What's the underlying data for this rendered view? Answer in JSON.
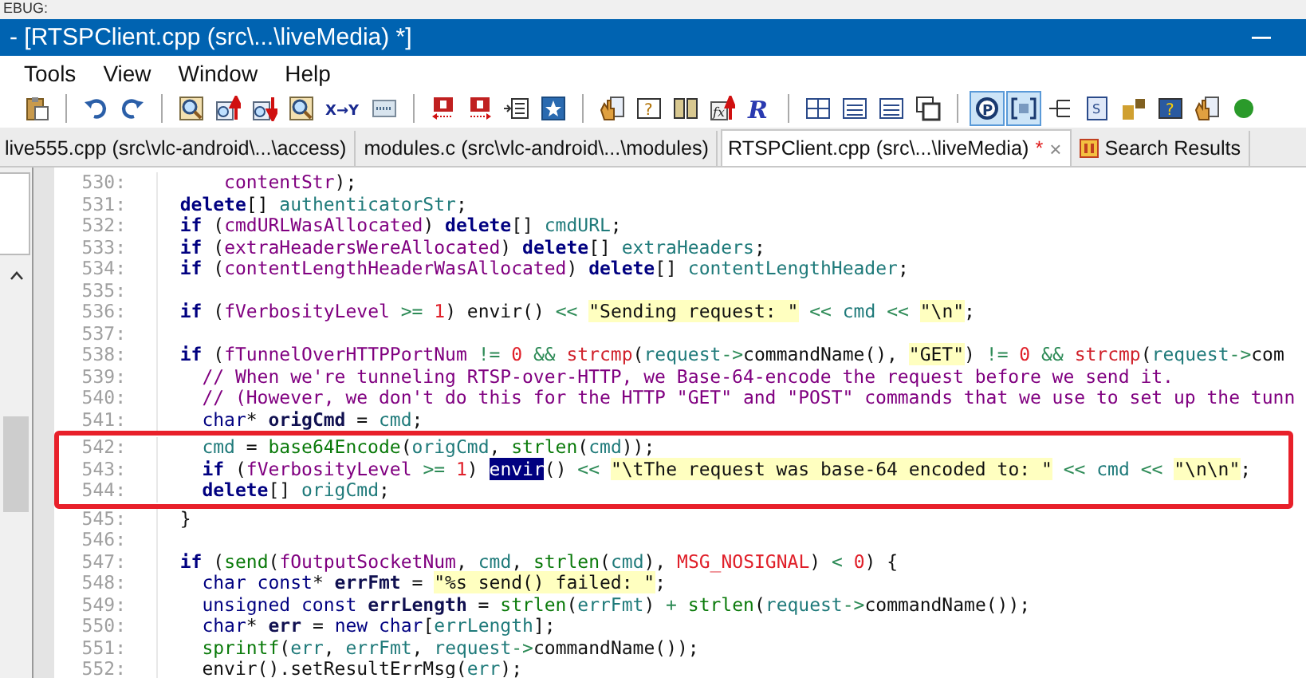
{
  "debug_strip": {
    "text": "EBUG:"
  },
  "window": {
    "title": "- [RTSPClient.cpp (src\\...\\liveMedia) *]"
  },
  "menu": [
    "Tools",
    "View",
    "Window",
    "Help"
  ],
  "toolbar": [
    {
      "kind": "paste",
      "pressed": false
    },
    {
      "kind": "separator"
    },
    {
      "kind": "undo",
      "pressed": false
    },
    {
      "kind": "redo",
      "pressed": false
    },
    {
      "kind": "separator"
    },
    {
      "kind": "find-page",
      "pressed": false
    },
    {
      "kind": "find-prev",
      "pressed": false
    },
    {
      "kind": "find-next",
      "pressed": false
    },
    {
      "kind": "find-page",
      "pressed": false
    },
    {
      "kind": "replace",
      "label": "X→Y",
      "pressed": false
    },
    {
      "kind": "web",
      "pressed": false
    },
    {
      "kind": "separator"
    },
    {
      "kind": "mark-prev",
      "pressed": false
    },
    {
      "kind": "mark-next",
      "pressed": false
    },
    {
      "kind": "indent",
      "pressed": false
    },
    {
      "kind": "star",
      "pressed": false
    },
    {
      "kind": "separator"
    },
    {
      "kind": "hand",
      "pressed": false
    },
    {
      "kind": "help-list",
      "label": "?",
      "pressed": false
    },
    {
      "kind": "book",
      "pressed": false
    },
    {
      "kind": "function",
      "label": "fx",
      "pressed": false
    },
    {
      "kind": "logo",
      "label": "R",
      "pressed": false
    },
    {
      "kind": "separator"
    },
    {
      "kind": "grid",
      "pressed": false
    },
    {
      "kind": "list",
      "pressed": false
    },
    {
      "kind": "list",
      "pressed": false
    },
    {
      "kind": "windows",
      "pressed": false
    },
    {
      "kind": "separator"
    },
    {
      "kind": "circle",
      "label": "P",
      "pressed": true
    },
    {
      "kind": "brackets",
      "pressed": true
    },
    {
      "kind": "tree",
      "pressed": false
    },
    {
      "kind": "doc",
      "label": "S",
      "pressed": false
    },
    {
      "kind": "puzzle",
      "pressed": false
    },
    {
      "kind": "help-box",
      "label": "?",
      "pressed": false
    },
    {
      "kind": "hand",
      "pressed": false
    },
    {
      "kind": "dot",
      "pressed": false
    }
  ],
  "tabs": [
    {
      "kind": "file",
      "label": "live555.cpp (src\\vlc-android\\...\\access)",
      "selected": false
    },
    {
      "kind": "file",
      "label": "modules.c (src\\vlc-android\\...\\modules)",
      "selected": false
    },
    {
      "kind": "file",
      "label": "RTSPClient.cpp (src\\...\\liveMedia)",
      "modified_mark": "*",
      "close": "×",
      "selected": true
    },
    {
      "kind": "search",
      "label": "Search Results",
      "selected": false
    }
  ],
  "code_lines": [
    {
      "number": "530:",
      "highlighted": false,
      "tokens": [
        {
          "kind": "var",
          "text": "      contentStr"
        },
        {
          "kind": "plain",
          "text": ");"
        }
      ]
    },
    {
      "number": "531:",
      "highlighted": false,
      "tokens": [
        {
          "kind": "kw",
          "text": "  delete"
        },
        {
          "kind": "plain",
          "text": "[] "
        },
        {
          "kind": "mem",
          "text": "authenticatorStr"
        },
        {
          "kind": "plain",
          "text": ";"
        }
      ]
    },
    {
      "number": "532:",
      "highlighted": false,
      "tokens": [
        {
          "kind": "kw",
          "text": "  if"
        },
        {
          "kind": "plain",
          "text": " ("
        },
        {
          "kind": "var",
          "text": "cmdURLWasAllocated"
        },
        {
          "kind": "plain",
          "text": ") "
        },
        {
          "kind": "kw",
          "text": "delete"
        },
        {
          "kind": "plain",
          "text": "[] "
        },
        {
          "kind": "mem",
          "text": "cmdURL"
        },
        {
          "kind": "plain",
          "text": ";"
        }
      ]
    },
    {
      "number": "533:",
      "highlighted": false,
      "tokens": [
        {
          "kind": "kw",
          "text": "  if"
        },
        {
          "kind": "plain",
          "text": " ("
        },
        {
          "kind": "var",
          "text": "extraHeadersWereAllocated"
        },
        {
          "kind": "plain",
          "text": ") "
        },
        {
          "kind": "kw",
          "text": "delete"
        },
        {
          "kind": "plain",
          "text": "[] "
        },
        {
          "kind": "mem",
          "text": "extraHeaders"
        },
        {
          "kind": "plain",
          "text": ";"
        }
      ]
    },
    {
      "number": "534:",
      "highlighted": false,
      "tokens": [
        {
          "kind": "kw",
          "text": "  if"
        },
        {
          "kind": "plain",
          "text": " ("
        },
        {
          "kind": "var",
          "text": "contentLengthHeaderWasAllocated"
        },
        {
          "kind": "plain",
          "text": ") "
        },
        {
          "kind": "kw",
          "text": "delete"
        },
        {
          "kind": "plain",
          "text": "[] "
        },
        {
          "kind": "mem",
          "text": "contentLengthHeader"
        },
        {
          "kind": "plain",
          "text": ";"
        }
      ]
    },
    {
      "number": "535:",
      "highlighted": false
    },
    {
      "number": "536:",
      "highlighted": false,
      "tokens": [
        {
          "kind": "kw",
          "text": "  if"
        },
        {
          "kind": "plain",
          "text": " ("
        },
        {
          "kind": "var",
          "text": "fVerbosityLevel"
        },
        {
          "kind": "op",
          "text": " >="
        },
        {
          "kind": "num",
          "text": " 1"
        },
        {
          "kind": "plain",
          "text": ") envir() "
        },
        {
          "kind": "op",
          "text": "<< "
        },
        {
          "kind": "str",
          "text": "\"Sending request: \""
        },
        {
          "kind": "op",
          "text": " << "
        },
        {
          "kind": "mem",
          "text": "cmd"
        },
        {
          "kind": "op",
          "text": " << "
        },
        {
          "kind": "str",
          "text": "\"\\n\""
        },
        {
          "kind": "plain",
          "text": ";"
        }
      ]
    },
    {
      "number": "537:",
      "highlighted": false
    },
    {
      "number": "538:",
      "highlighted": false,
      "tokens": [
        {
          "kind": "kw",
          "text": "  if"
        },
        {
          "kind": "plain",
          "text": " ("
        },
        {
          "kind": "var",
          "text": "fTunnelOverHTTPPortNum"
        },
        {
          "kind": "op",
          "text": " != "
        },
        {
          "kind": "num",
          "text": "0"
        },
        {
          "kind": "op",
          "text": " && "
        },
        {
          "kind": "builtin",
          "text": "strcmp"
        },
        {
          "kind": "plain",
          "text": "("
        },
        {
          "kind": "mem",
          "text": "request"
        },
        {
          "kind": "op",
          "text": "->"
        },
        {
          "kind": "plain",
          "text": "commandName(), "
        },
        {
          "kind": "str",
          "text": "\"GET\""
        },
        {
          "kind": "plain",
          "text": ") "
        },
        {
          "kind": "op",
          "text": "!= "
        },
        {
          "kind": "num",
          "text": "0"
        },
        {
          "kind": "op",
          "text": " && "
        },
        {
          "kind": "builtin",
          "text": "strcmp"
        },
        {
          "kind": "plain",
          "text": "("
        },
        {
          "kind": "mem",
          "text": "request"
        },
        {
          "kind": "op",
          "text": "->"
        },
        {
          "kind": "plain",
          "text": "com"
        }
      ]
    },
    {
      "number": "539:",
      "highlighted": false,
      "tokens": [
        {
          "kind": "com",
          "text": "    // When we're tunneling RTSP-over-HTTP, we Base-64-encode the request before we send it."
        }
      ]
    },
    {
      "number": "540:",
      "highlighted": false,
      "tokens": [
        {
          "kind": "com",
          "text": "    // (However, we don't do this for the HTTP \"GET\" and \"POST\" commands that we use to set up the tunn"
        }
      ]
    },
    {
      "number": "541:",
      "highlighted": false,
      "tokens": [
        {
          "kind": "type",
          "text": "    char"
        },
        {
          "kind": "plain",
          "text": "* "
        },
        {
          "kind": "decl",
          "text": "origCmd"
        },
        {
          "kind": "plain",
          "text": " = "
        },
        {
          "kind": "mem",
          "text": "cmd"
        },
        {
          "kind": "plain",
          "text": ";"
        }
      ]
    },
    {
      "number": "542:",
      "highlighted": true,
      "tokens": [
        {
          "kind": "mem",
          "text": "    cmd"
        },
        {
          "kind": "plain",
          "text": " = "
        },
        {
          "kind": "fn",
          "text": "base64Encode"
        },
        {
          "kind": "plain",
          "text": "("
        },
        {
          "kind": "mem",
          "text": "origCmd"
        },
        {
          "kind": "plain",
          "text": ", "
        },
        {
          "kind": "fn",
          "text": "strlen"
        },
        {
          "kind": "plain",
          "text": "("
        },
        {
          "kind": "mem",
          "text": "cmd"
        },
        {
          "kind": "plain",
          "text": "));"
        }
      ]
    },
    {
      "number": "543:",
      "highlighted": true,
      "tokens": [
        {
          "kind": "kw",
          "text": "    if"
        },
        {
          "kind": "plain",
          "text": " ("
        },
        {
          "kind": "var",
          "text": "fVerbosityLevel"
        },
        {
          "kind": "op",
          "text": " >="
        },
        {
          "kind": "num",
          "text": " 1"
        },
        {
          "kind": "plain",
          "text": ") "
        },
        {
          "kind": "selected",
          "text": "envir"
        },
        {
          "kind": "plain",
          "text": "() "
        },
        {
          "kind": "op",
          "text": "<< "
        },
        {
          "kind": "str",
          "text": "\"\\tThe request was base-64 encoded to: \""
        },
        {
          "kind": "op",
          "text": " << "
        },
        {
          "kind": "mem",
          "text": "cmd"
        },
        {
          "kind": "op",
          "text": " << "
        },
        {
          "kind": "str",
          "text": "\"\\n\\n\""
        },
        {
          "kind": "plain",
          "text": ";"
        }
      ]
    },
    {
      "number": "544:",
      "highlighted": true,
      "tokens": [
        {
          "kind": "kw",
          "text": "    delete"
        },
        {
          "kind": "plain",
          "text": "[] "
        },
        {
          "kind": "mem",
          "text": "origCmd"
        },
        {
          "kind": "plain",
          "text": ";"
        }
      ]
    },
    {
      "number": "545:",
      "highlighted": false,
      "tokens": [
        {
          "kind": "plain",
          "text": "  }"
        }
      ]
    },
    {
      "number": "546:",
      "highlighted": false
    },
    {
      "number": "547:",
      "highlighted": false,
      "tokens": [
        {
          "kind": "kw",
          "text": "  if"
        },
        {
          "kind": "plain",
          "text": " ("
        },
        {
          "kind": "fn",
          "text": "send"
        },
        {
          "kind": "plain",
          "text": "("
        },
        {
          "kind": "var",
          "text": "fOutputSocketNum"
        },
        {
          "kind": "plain",
          "text": ", "
        },
        {
          "kind": "mem",
          "text": "cmd"
        },
        {
          "kind": "plain",
          "text": ", "
        },
        {
          "kind": "fn",
          "text": "strlen"
        },
        {
          "kind": "plain",
          "text": "("
        },
        {
          "kind": "mem",
          "text": "cmd"
        },
        {
          "kind": "plain",
          "text": "), "
        },
        {
          "kind": "macro",
          "text": "MSG_NOSIGNAL"
        },
        {
          "kind": "plain",
          "text": ") "
        },
        {
          "kind": "op",
          "text": "< "
        },
        {
          "kind": "num",
          "text": "0"
        },
        {
          "kind": "plain",
          "text": ") {"
        }
      ]
    },
    {
      "number": "548:",
      "highlighted": false,
      "tokens": [
        {
          "kind": "type",
          "text": "    char const"
        },
        {
          "kind": "plain",
          "text": "* "
        },
        {
          "kind": "decl",
          "text": "errFmt"
        },
        {
          "kind": "plain",
          "text": " = "
        },
        {
          "kind": "str",
          "text": "\"%s send() failed: \""
        },
        {
          "kind": "plain",
          "text": ";"
        }
      ]
    },
    {
      "number": "549:",
      "highlighted": false,
      "tokens": [
        {
          "kind": "type",
          "text": "    unsigned const "
        },
        {
          "kind": "decl",
          "text": "errLength"
        },
        {
          "kind": "plain",
          "text": " = "
        },
        {
          "kind": "fn",
          "text": "strlen"
        },
        {
          "kind": "plain",
          "text": "("
        },
        {
          "kind": "mem",
          "text": "errFmt"
        },
        {
          "kind": "plain",
          "text": ") "
        },
        {
          "kind": "op",
          "text": "+ "
        },
        {
          "kind": "fn",
          "text": "strlen"
        },
        {
          "kind": "plain",
          "text": "("
        },
        {
          "kind": "mem",
          "text": "request"
        },
        {
          "kind": "op",
          "text": "->"
        },
        {
          "kind": "plain",
          "text": "commandName());"
        }
      ]
    },
    {
      "number": "550:",
      "highlighted": false,
      "tokens": [
        {
          "kind": "type",
          "text": "    char"
        },
        {
          "kind": "plain",
          "text": "* "
        },
        {
          "kind": "decl",
          "text": "err"
        },
        {
          "kind": "plain",
          "text": " = "
        },
        {
          "kind": "type",
          "text": "new char"
        },
        {
          "kind": "plain",
          "text": "["
        },
        {
          "kind": "mem",
          "text": "errLength"
        },
        {
          "kind": "plain",
          "text": "];"
        }
      ]
    },
    {
      "number": "551:",
      "highlighted": false,
      "tokens": [
        {
          "kind": "fn",
          "text": "    sprintf"
        },
        {
          "kind": "plain",
          "text": "("
        },
        {
          "kind": "mem",
          "text": "err"
        },
        {
          "kind": "plain",
          "text": ", "
        },
        {
          "kind": "mem",
          "text": "errFmt"
        },
        {
          "kind": "plain",
          "text": ", "
        },
        {
          "kind": "mem",
          "text": "request"
        },
        {
          "kind": "op",
          "text": "->"
        },
        {
          "kind": "plain",
          "text": "commandName());"
        }
      ]
    },
    {
      "number": "552:",
      "highlighted": false,
      "tokens": [
        {
          "kind": "plain",
          "text": "    envir().setResultErrMsg("
        },
        {
          "kind": "mem",
          "text": "err"
        },
        {
          "kind": "plain",
          "text": ");"
        }
      ]
    }
  ]
}
